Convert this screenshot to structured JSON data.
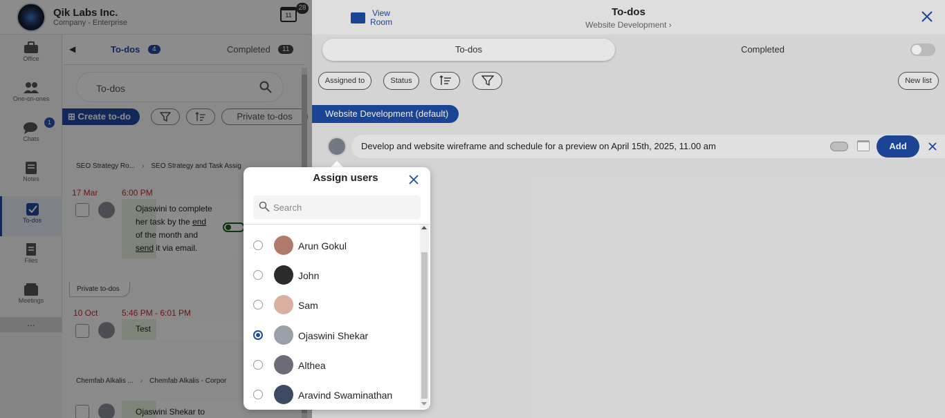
{
  "app": {
    "company_name": "Qik Labs Inc.",
    "company_sub": "Company - Enterprise",
    "calendar_day": "11",
    "calendar_badge": "28"
  },
  "sidenav": {
    "items": [
      {
        "label": "Office",
        "icon": "briefcase-icon"
      },
      {
        "label": "One-on-ones",
        "icon": "people-icon"
      },
      {
        "label": "Chats",
        "icon": "chat-icon"
      },
      {
        "label": "Notes",
        "icon": "notes-icon"
      },
      {
        "label": "To-dos",
        "icon": "checkbox-icon"
      },
      {
        "label": "Files",
        "icon": "files-icon"
      },
      {
        "label": "Meetings",
        "icon": "meetings-icon"
      }
    ],
    "chats_badge": "1",
    "more": "..."
  },
  "todo_pane": {
    "tab_todos": "To-dos",
    "tab_todos_count": "4",
    "tab_completed": "Completed",
    "tab_completed_count": "11",
    "search_value": "To-dos",
    "create_label": "Create to-do",
    "private_label": "Private to-dos",
    "group1_crumb_a": "SEO Strategy Ro...",
    "group1_crumb_b": "SEO Strategy and Task Assig",
    "task1_date": "17 Mar",
    "task1_time": "6:00 PM",
    "task1_text_a": "Ojaswini to complete",
    "task1_text_b": "her task by the",
    "task1_text_b2": "end",
    "task1_text_c": "of the month and",
    "task1_text_d1": "send",
    "task1_text_d2": "it via email.",
    "private_tag": "Private to-dos",
    "task2_date": "10 Oct",
    "task2_time": "5:46 PM  -  6:01 PM",
    "task2_text": "Test",
    "group2_crumb_a": "Chemfab Alkalis ...",
    "group2_crumb_b": "Chemfab Alkalis - Corpor",
    "task3_text": "Ojaswini Shekar to"
  },
  "right_panel": {
    "view_room_1": "View",
    "view_room_2": "Room",
    "title": "To-dos",
    "subtitle": "Website Development",
    "tab_todos": "To-dos",
    "tab_completed": "Completed",
    "filter_assigned": "Assigned to",
    "filter_status": "Status",
    "new_list": "New list",
    "list_name": "Website Development (default)",
    "todo_input_value": "Develop and website wireframe and schedule for a preview on April 15th, 2025, 11.00 am",
    "add_label": "Add"
  },
  "assign_popup": {
    "title": "Assign users",
    "search_placeholder": "Search",
    "users": [
      {
        "name": "Arun Gokul",
        "selected": false,
        "avatar_color": "#b07a6a"
      },
      {
        "name": "John",
        "selected": false,
        "avatar_color": "#2b2b2b"
      },
      {
        "name": "Sam",
        "selected": false,
        "avatar_color": "#d9b0a0"
      },
      {
        "name": "Ojaswini Shekar",
        "selected": true,
        "avatar_color": "#9aa0aa"
      },
      {
        "name": "Althea",
        "selected": false,
        "avatar_color": "#6f6a78"
      },
      {
        "name": "Aravind Swaminathan",
        "selected": false,
        "avatar_color": "#3d4a63"
      }
    ]
  },
  "colors": {
    "brand": "#1f4aa0",
    "date_red": "#c62828"
  }
}
